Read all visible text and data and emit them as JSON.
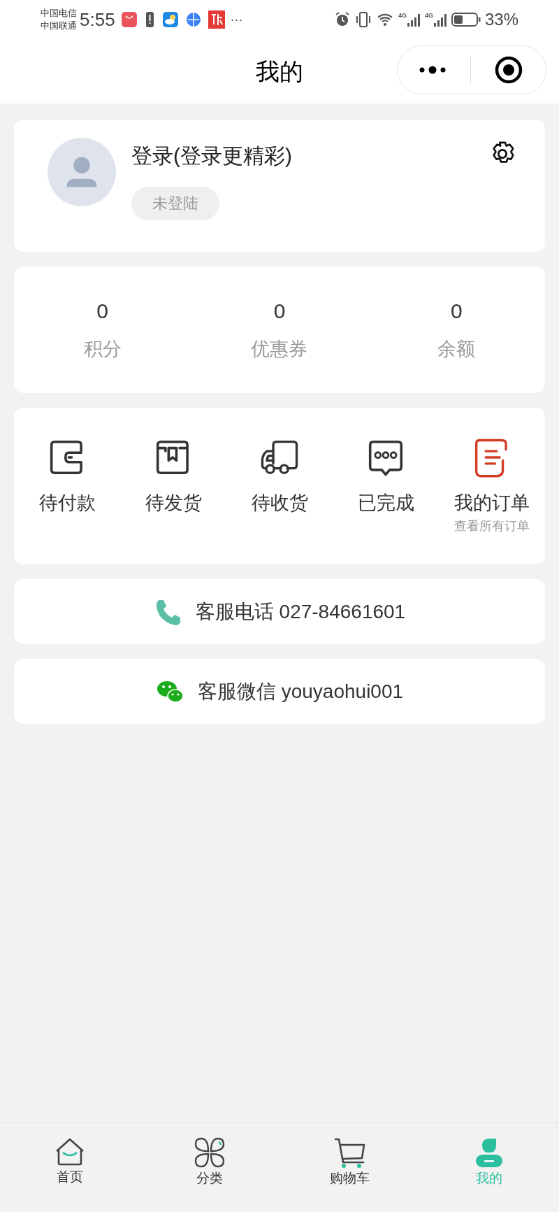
{
  "status_bar": {
    "carriers": [
      "中国电信",
      "中国联通"
    ],
    "time": "5:55",
    "more": "···",
    "network_1": "4G",
    "network_2": "4G",
    "battery": "33%"
  },
  "nav": {
    "title": "我的"
  },
  "profile": {
    "name": "登录(登录更精彩)",
    "status_badge": "未登陆"
  },
  "stats": [
    {
      "value": "0",
      "label": "积分"
    },
    {
      "value": "0",
      "label": "优惠券"
    },
    {
      "value": "0",
      "label": "余额"
    }
  ],
  "orders": [
    {
      "kind": "wallet",
      "label": "待付款"
    },
    {
      "kind": "box",
      "label": "待发货"
    },
    {
      "kind": "truck",
      "label": "待收货"
    },
    {
      "kind": "chat",
      "label": "已完成"
    },
    {
      "kind": "list",
      "label": "我的订单",
      "sublabel": "查看所有订单"
    }
  ],
  "contacts": [
    {
      "kind": "phone",
      "text": "客服电话 027-84661601"
    },
    {
      "kind": "wechat",
      "text": "客服微信 youyaohui001"
    }
  ],
  "tab_bar": [
    {
      "kind": "home",
      "label": "首页",
      "selected": false
    },
    {
      "kind": "category",
      "label": "分类",
      "selected": false
    },
    {
      "kind": "cart",
      "label": "购物车",
      "selected": false
    },
    {
      "kind": "me",
      "label": "我的",
      "selected": true
    }
  ]
}
